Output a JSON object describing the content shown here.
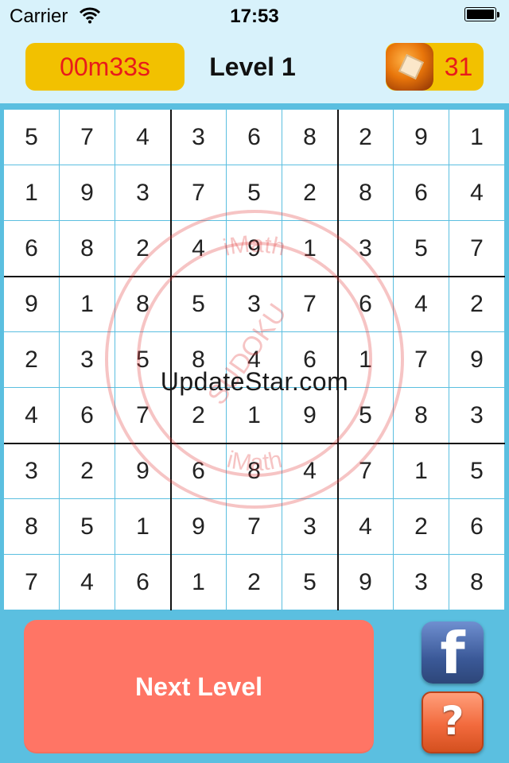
{
  "status_bar": {
    "carrier": "Carrier",
    "time": "17:53",
    "wifi_icon": "wifi-icon",
    "battery_icon": "battery-icon"
  },
  "header": {
    "timer": "00m33s",
    "level": "Level 1",
    "coins": "31",
    "coin_icon": "coin-icon"
  },
  "board": {
    "rows": [
      [
        "5",
        "7",
        "4",
        "3",
        "6",
        "8",
        "2",
        "9",
        "1"
      ],
      [
        "1",
        "9",
        "3",
        "7",
        "5",
        "2",
        "8",
        "6",
        "4"
      ],
      [
        "6",
        "8",
        "2",
        "4",
        "9",
        "1",
        "3",
        "5",
        "7"
      ],
      [
        "9",
        "1",
        "8",
        "5",
        "3",
        "7",
        "6",
        "4",
        "2"
      ],
      [
        "2",
        "3",
        "5",
        "8",
        "4",
        "6",
        "1",
        "7",
        "9"
      ],
      [
        "4",
        "6",
        "7",
        "2",
        "1",
        "9",
        "5",
        "8",
        "3"
      ],
      [
        "3",
        "2",
        "9",
        "6",
        "8",
        "4",
        "7",
        "1",
        "5"
      ],
      [
        "8",
        "5",
        "1",
        "9",
        "7",
        "3",
        "4",
        "2",
        "6"
      ],
      [
        "7",
        "4",
        "6",
        "1",
        "2",
        "5",
        "9",
        "3",
        "8"
      ]
    ],
    "stamp_text_top": "iMath",
    "stamp_text_bottom": "iMath",
    "stamp_center": "SUDOKU",
    "watermark": "UpdateStar.com"
  },
  "actions": {
    "next_level_label": "Next Level",
    "facebook_label": "f",
    "help_label": "?"
  },
  "colors": {
    "background": "#5bbfe0",
    "header_bg": "#d8f2fb",
    "accent_yellow": "#f2c100",
    "timer_text": "#e81b1b",
    "next_button": "#ff7565",
    "grid_line": "#5bbfe0",
    "facebook": "#3b5998",
    "help": "#f26a3d"
  }
}
